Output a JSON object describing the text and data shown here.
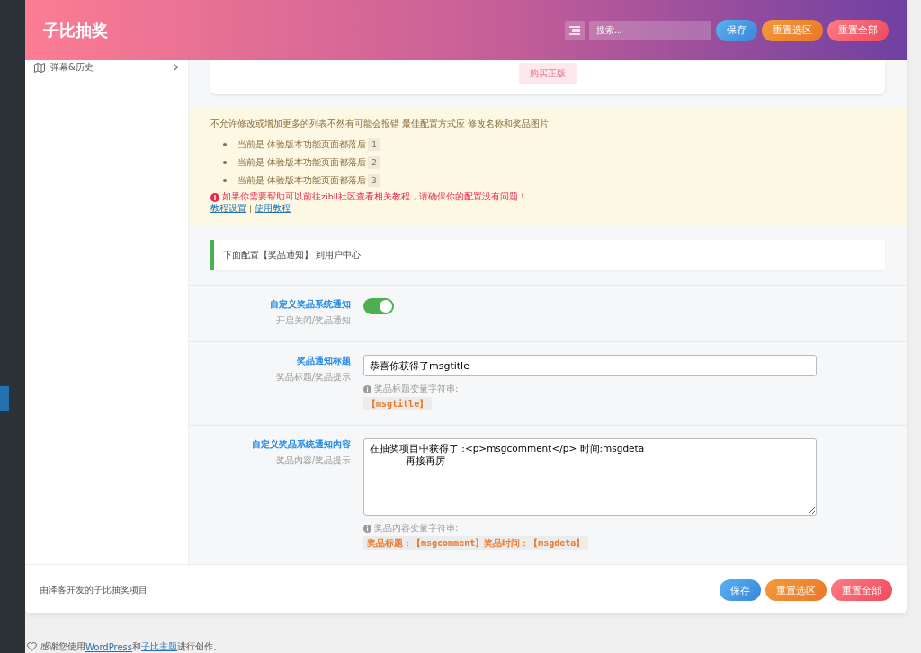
{
  "header": {
    "title": "子比抽奖",
    "search_placeholder": "搜索...",
    "buttons": [
      {
        "label": "保存",
        "kind": "save"
      },
      {
        "label": "重置选区",
        "kind": "section"
      },
      {
        "label": "重置全部",
        "kind": "all"
      }
    ]
  },
  "sidebar": {
    "items": [
      {
        "label": "弹幕&历史",
        "expanded": false
      }
    ]
  },
  "buy_button": "购买正版",
  "notice": {
    "text": "不允许修改或增加更多的列表不然有可能会报错 最佳配置方式应 修改名称和奖品图片",
    "items": [
      {
        "text": "当前是 体验版本功能页面都落后",
        "badge": "1"
      },
      {
        "text": "当前是 体验版本功能页面都落后",
        "badge": "2"
      },
      {
        "text": "当前是 体验版本功能页面都落后",
        "badge": "3"
      }
    ],
    "warning": "如果你需要帮助可以前往zibll社区查看相关教程，请确保你的配置没有问题！",
    "links": [
      "教程设置",
      "使用教程"
    ],
    "separator": "|"
  },
  "section_heading": "下面配置【奖品通知】 到用户中心",
  "fields": [
    {
      "kind": "switch",
      "label": "自定义奖品系统通知",
      "help": "开启关闭/奖品通知",
      "on": true
    },
    {
      "kind": "text",
      "label": "奖品通知标题",
      "help": "奖品标题/奖品提示",
      "value": "恭喜你获得了msgtitle",
      "hint": "奖品标题变量字符串:",
      "code": "【msgtitle】"
    },
    {
      "kind": "textarea",
      "label": "自定义奖品系统通知内容",
      "help": "奖品内容/奖品提示",
      "value": "在抽奖项目中获得了 :<p>msgcomment</p> 时间:msgdeta\n            再接再厉",
      "hint": "奖品内容变量字符串:",
      "code": "奖品标题：【msgcomment】奖品时间：【msgdeta】"
    }
  ],
  "footer": {
    "text": "由泽客开发的子比抽奖项目",
    "buttons": [
      {
        "label": "保存",
        "kind": "save"
      },
      {
        "label": "重置选区",
        "kind": "section"
      },
      {
        "label": "重置全部",
        "kind": "all"
      }
    ]
  },
  "credit": {
    "before": "感谢您使用",
    "link1": "WordPress",
    "middle": "和",
    "link2": "子比主题",
    "after": "进行创作。"
  }
}
